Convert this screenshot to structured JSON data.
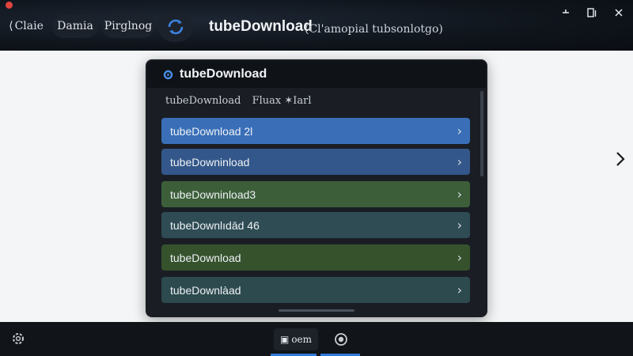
{
  "titlebar": {
    "back_label": "Claie",
    "tab_a": "Damia",
    "tab_b": "Pirglnog",
    "app_title": "tubeDownload",
    "app_subtitle": "(Cl'amopial tubsonlotgo)"
  },
  "panel": {
    "title": "tubeDownload",
    "sub_primary": "tubeDownload",
    "sub_secondary": "Fluax ✶Iarl",
    "items": [
      {
        "label": "tubeDownload 2l",
        "color": "#3a6fb8"
      },
      {
        "label": "tubeDowninload",
        "color": "#33578a"
      },
      {
        "label": "tubeDowninload3",
        "color": "#3c5f3a"
      },
      {
        "label": "tubeDownlıdād 46",
        "color": "#2f4c55"
      },
      {
        "label": "tubeDownload",
        "color": "#35522d"
      },
      {
        "label": "tubeDownlàad",
        "color": "#2d4a4e"
      }
    ]
  },
  "bottombar": {
    "open_label": "oem"
  },
  "icons": {
    "back": "chevron-left-icon",
    "sync": "sync-icon",
    "logo": "app-logo-icon",
    "item_arrow": "chevron-right-icon",
    "next": "chevron-right-icon",
    "settings": "settings-icon",
    "record": "record-icon"
  },
  "colors": {
    "accent": "#2f7ad9",
    "panel_bg": "#1a1e24",
    "titlebar_bg": "#0f141b"
  }
}
